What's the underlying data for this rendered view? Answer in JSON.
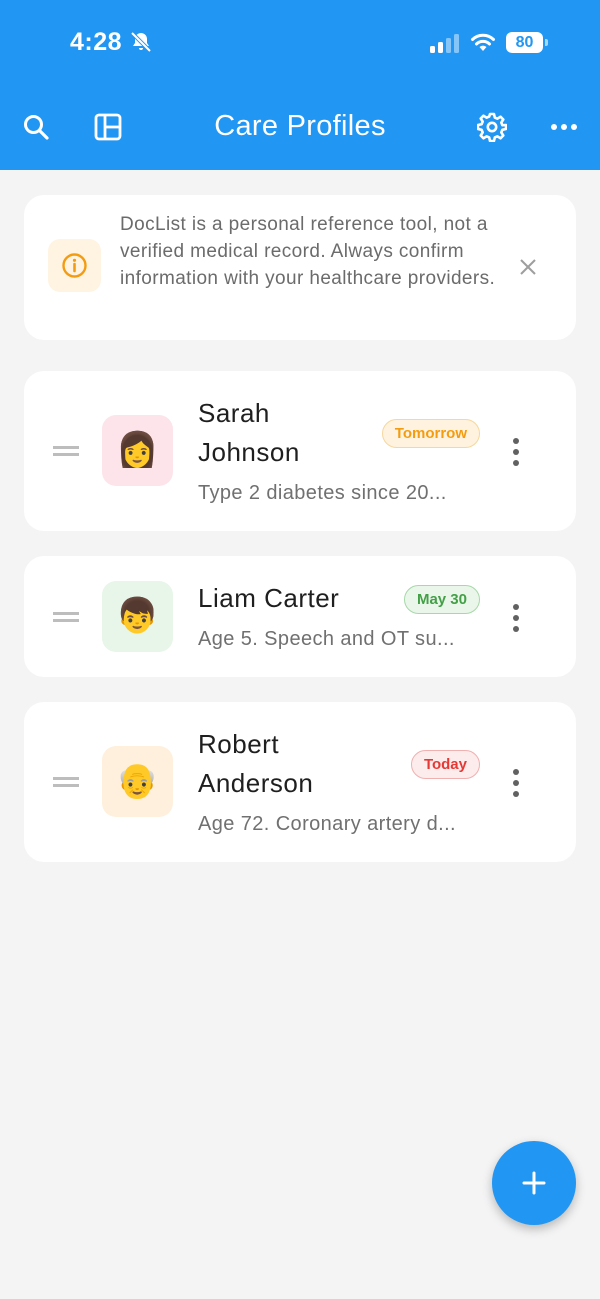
{
  "status_bar": {
    "time": "4:28",
    "battery": "80"
  },
  "header": {
    "title": "Care Profiles",
    "left_icons": [
      "search-icon",
      "layout-icon"
    ],
    "right_icons": [
      "gear-icon",
      "more-horizontal-icon"
    ],
    "color": "#2196f3"
  },
  "notice": {
    "text": "DocList is a personal reference tool, not a verified medical record. Always confirm information with your healthcare providers.",
    "icon": "info-icon"
  },
  "profiles": [
    {
      "name": "Sarah Johnson",
      "emoji": "👩",
      "badge": "Tomorrow",
      "badge_color": "orange",
      "avatar_bg": "#fde4ea",
      "description": "Type 2 diabetes since 20..."
    },
    {
      "name": "Liam Carter",
      "emoji": "👦",
      "badge": "May 30",
      "badge_color": "green",
      "avatar_bg": "#e8f5e9",
      "description": "Age 5. Speech and OT su..."
    },
    {
      "name": "Robert Anderson",
      "emoji": "👴",
      "badge": "Today",
      "badge_color": "red",
      "avatar_bg": "#fff0dd",
      "description": "Age 72. Coronary artery d..."
    }
  ],
  "fab": {
    "icon": "plus-icon"
  }
}
